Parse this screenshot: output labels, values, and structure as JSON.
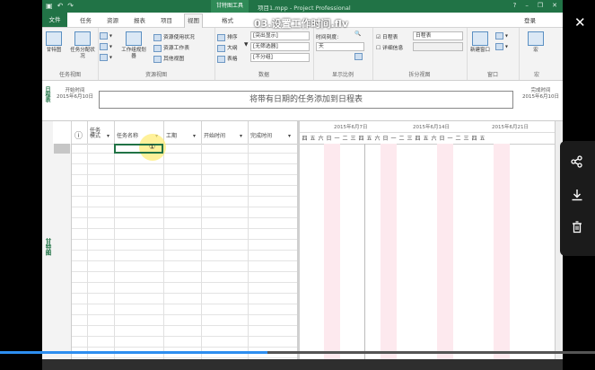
{
  "video": {
    "title": "03.设置工作时间.flv",
    "progress": 0.45
  },
  "window": {
    "title": "项目1.mpp - Project Professional",
    "context_tab": "甘特图工具",
    "buttons": [
      "?",
      "–",
      "❐",
      "✕"
    ],
    "signin": "登录"
  },
  "tabs": [
    "文件",
    "任务",
    "资源",
    "报表",
    "项目",
    "视图",
    "格式"
  ],
  "active_tab": "视图",
  "ribbon": {
    "groups": [
      {
        "label": "任务视图",
        "items": [
          "甘特图",
          "任务分配状况"
        ]
      },
      {
        "label": "资源视图",
        "items": [
          "工作组规划器",
          "资源使用状况",
          "资源工作表",
          "其他视图"
        ]
      },
      {
        "label": "数据",
        "items": [
          "排序",
          "大纲",
          "表格",
          "[突出显示]",
          "[无筛选器]",
          "[不分组]"
        ]
      },
      {
        "label": "显示比例",
        "items": [
          "时间刻度:",
          "天"
        ]
      },
      {
        "label": "拆分视图",
        "items": [
          "日程表",
          "详细信息",
          "日程表"
        ]
      },
      {
        "label": "窗口",
        "items": [
          "新建窗口"
        ]
      },
      {
        "label": "宏",
        "items": [
          "宏"
        ]
      }
    ]
  },
  "timeline": {
    "side_label": "日程表",
    "start_label": "开始时间",
    "start_date": "2015年6月10日",
    "end_label": "完成时间",
    "end_date": "2015年6月10日",
    "placeholder": "将带有日期的任务添加到日程表"
  },
  "grid": {
    "side_label": "甘特图",
    "columns": [
      "任务模式",
      "任务名称",
      "工期",
      "开始时间",
      "完成时间"
    ],
    "cursor_glyph": "①"
  },
  "gantt": {
    "weeks": [
      "2015年6月7日",
      "2015年6月14日",
      "2015年6月21日"
    ],
    "days": [
      "四",
      "五",
      "六",
      "日",
      "一",
      "二",
      "三",
      "四",
      "五",
      "六",
      "日",
      "一",
      "二",
      "三",
      "四",
      "五",
      "六",
      "日",
      "一",
      "二",
      "三",
      "四",
      "五"
    ]
  },
  "side_panel": {
    "icons": [
      "share-icon",
      "download-icon",
      "trash-icon"
    ]
  }
}
